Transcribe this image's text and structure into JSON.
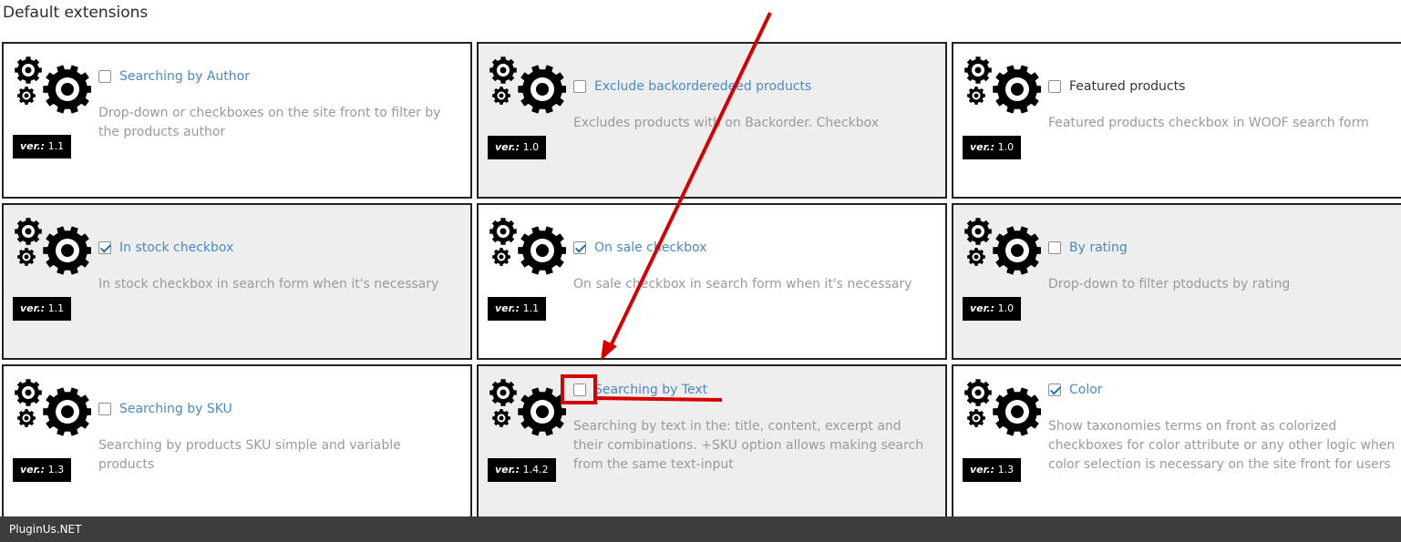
{
  "page": {
    "title": "Default extensions",
    "footer_brand": "PluginUs.NET"
  },
  "version_prefix": "ver.:",
  "cards": [
    {
      "title": "Searching by Author",
      "description": "Drop-down or checkboxes on the site front to filter by the products author",
      "version": "1.1",
      "checked": false,
      "grey": false,
      "title_link": true
    },
    {
      "title": "Exclude backorderedeed products",
      "description": "Excludes products with on Backorder. Checkbox",
      "version": "1.0",
      "checked": false,
      "grey": true,
      "title_link": true
    },
    {
      "title": "Featured products",
      "description": "Featured products checkbox in WOOF search form",
      "version": "1.0",
      "checked": false,
      "grey": false,
      "title_link": false
    },
    {
      "title": "In stock checkbox",
      "description": "In stock checkbox in search form when it's necessary",
      "version": "1.1",
      "checked": true,
      "grey": true,
      "title_link": true
    },
    {
      "title": "On sale checkbox",
      "description": "On sale checkbox in search form when it's necessary",
      "version": "1.1",
      "checked": true,
      "grey": false,
      "title_link": true
    },
    {
      "title": "By rating",
      "description": "Drop-down to filter ptoducts by rating",
      "version": "1.0",
      "checked": false,
      "grey": true,
      "title_link": true
    },
    {
      "title": "Searching by SKU",
      "description": "Searching by products SKU simple and variable products",
      "version": "1.3",
      "checked": false,
      "grey": false,
      "title_link": true
    },
    {
      "title": "Searching by Text",
      "description": "Searching by text in the: title, content, excerpt and their combinations. +SKU option allows making search from the same text-input",
      "version": "1.4.2",
      "checked": false,
      "grey": true,
      "title_link": true
    },
    {
      "title": "Color",
      "description": "Show taxonomies terms on front as colorized checkboxes for color attribute or any other logic when color selection is necessary on the site front for users",
      "version": "1.3",
      "checked": true,
      "grey": false,
      "title_link": true
    }
  ],
  "colors": {
    "annotation": "#d40000",
    "link": "#4a8ac4",
    "checkbox_check": "#2271b1"
  },
  "icons": {
    "extension": "gears-icon"
  }
}
